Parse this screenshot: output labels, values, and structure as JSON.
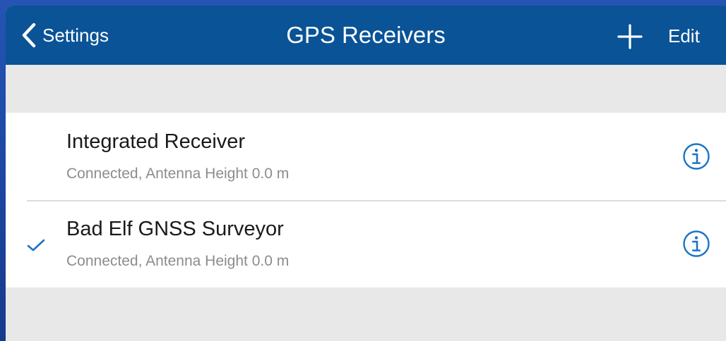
{
  "navbar": {
    "back_label": "Settings",
    "title": "GPS Receivers",
    "add_icon": "plus-icon",
    "edit_label": "Edit",
    "background_color": "#0a5396"
  },
  "receivers": [
    {
      "name": "Integrated Receiver",
      "status": "Connected, Antenna Height 0.0 m",
      "selected": false,
      "info_icon": "info-icon"
    },
    {
      "name": "Bad Elf GNSS Surveyor",
      "status": "Connected, Antenna Height 0.0 m",
      "selected": true,
      "info_icon": "info-icon"
    }
  ],
  "colors": {
    "accent": "#1a73c7",
    "background": "#e8e8e8"
  }
}
